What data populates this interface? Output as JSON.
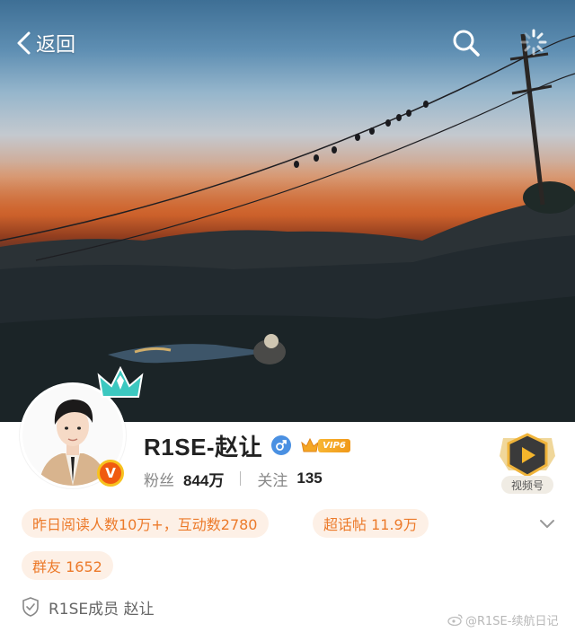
{
  "nav": {
    "back_label": "返回"
  },
  "profile": {
    "name": "R1SE-赵让",
    "vip_label": "VIP6",
    "avatar_badge": "V",
    "followers_label": "粉丝",
    "followers_value": "844万",
    "following_label": "关注",
    "following_value": "135",
    "video_channel_label": "视频号"
  },
  "pills": {
    "reads": "昨日阅读人数10万+，互动数2780",
    "super_topic": "超话帖  11.9万",
    "group_friends": "群友  1652"
  },
  "verification": {
    "text": "R1SE成员  赵让"
  },
  "watermark": {
    "text": "@R1SE-续航日记"
  },
  "colors": {
    "accent_orange": "#ec7a2a",
    "pill_bg": "#fdf0e6",
    "gender_blue": "#4a90e2",
    "vip_gold": "#f09819",
    "badge_orange": "#f05a10"
  },
  "icons": {
    "back": "chevron-left-icon",
    "search": "search-icon",
    "loading": "loading-spinner-icon",
    "gender": "male-icon",
    "expand": "chevron-down-icon",
    "verify": "shield-icon",
    "video": "play-icon"
  }
}
